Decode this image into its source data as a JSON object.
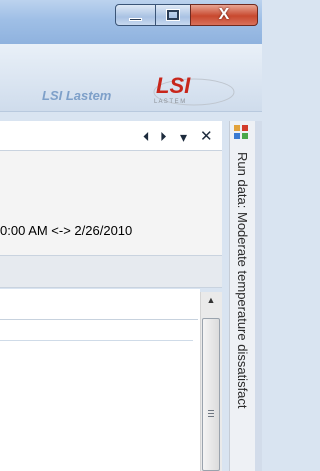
{
  "window": {
    "minimize_label": "",
    "maximize_label": "",
    "close_label": "X"
  },
  "header": {
    "brand_text": "LSI Lastem",
    "logo_text": "LSI",
    "logo_subtext": "L A S T E M",
    "colors": {
      "logo_red": "#c8261b",
      "logo_gray": "#8a8f96",
      "brand_blue": "#7ea0c9"
    }
  },
  "panel": {
    "nav_prev": "⏴",
    "nav_next": "⏵",
    "dropdown": "▾",
    "close": "✕",
    "date_range": "0:00 AM <-> 2/26/2010"
  },
  "side_tab": {
    "label": "Run data: Moderate temperature dissatisfact"
  },
  "scrollbar": {
    "up_arrow": "▲"
  }
}
